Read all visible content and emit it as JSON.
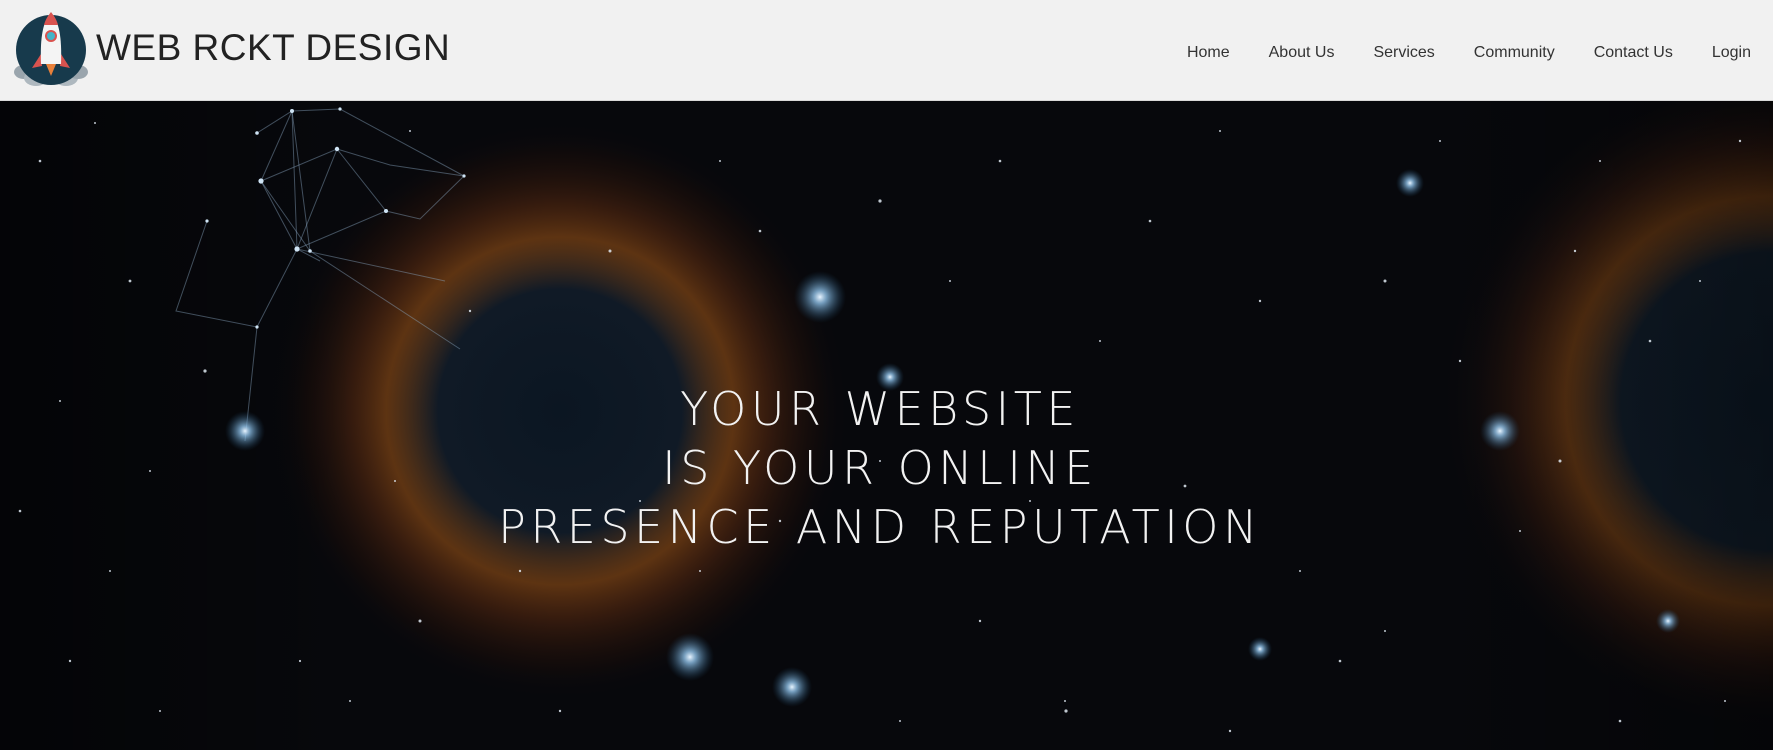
{
  "brand": {
    "name": "WEB RCKT DESIGN",
    "logo_icon": "rocket-icon"
  },
  "nav": {
    "items": [
      {
        "label": "Home"
      },
      {
        "label": "About Us"
      },
      {
        "label": "Services"
      },
      {
        "label": "Community"
      },
      {
        "label": "Contact Us"
      },
      {
        "label": "Login"
      }
    ]
  },
  "hero": {
    "lines": [
      "YOUR WEBSITE",
      "IS YOUR ONLINE",
      "PRESENCE AND REPUTATION"
    ],
    "background": "helix nebula starfield"
  },
  "colors": {
    "topbar_bg": "#f1f1f1",
    "hero_bg": "#07080c",
    "nebula_orange": "#b5651d",
    "text_light": "#f2f2f2"
  }
}
